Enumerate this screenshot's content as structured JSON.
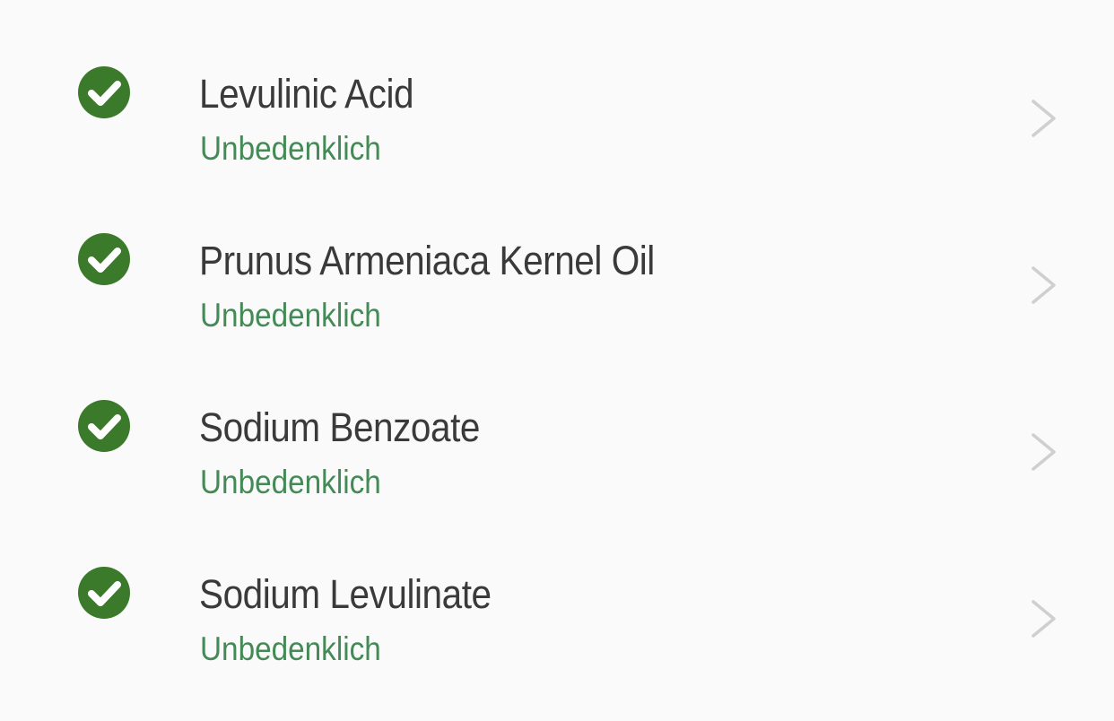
{
  "colors": {
    "background": "#fafafa",
    "check_circle": "#3b7a2a",
    "name_text": "#3a3a3a",
    "status_text": "#438a56",
    "chevron": "#cfcfcf"
  },
  "ingredients": [
    {
      "name": "Levulinic Acid",
      "status": "Unbedenklich",
      "icon": "check-circle-icon"
    },
    {
      "name": "Prunus Armeniaca Kernel Oil",
      "status": "Unbedenklich",
      "icon": "check-circle-icon"
    },
    {
      "name": "Sodium Benzoate",
      "status": "Unbedenklich",
      "icon": "check-circle-icon"
    },
    {
      "name": "Sodium Levulinate",
      "status": "Unbedenklich",
      "icon": "check-circle-icon"
    }
  ]
}
